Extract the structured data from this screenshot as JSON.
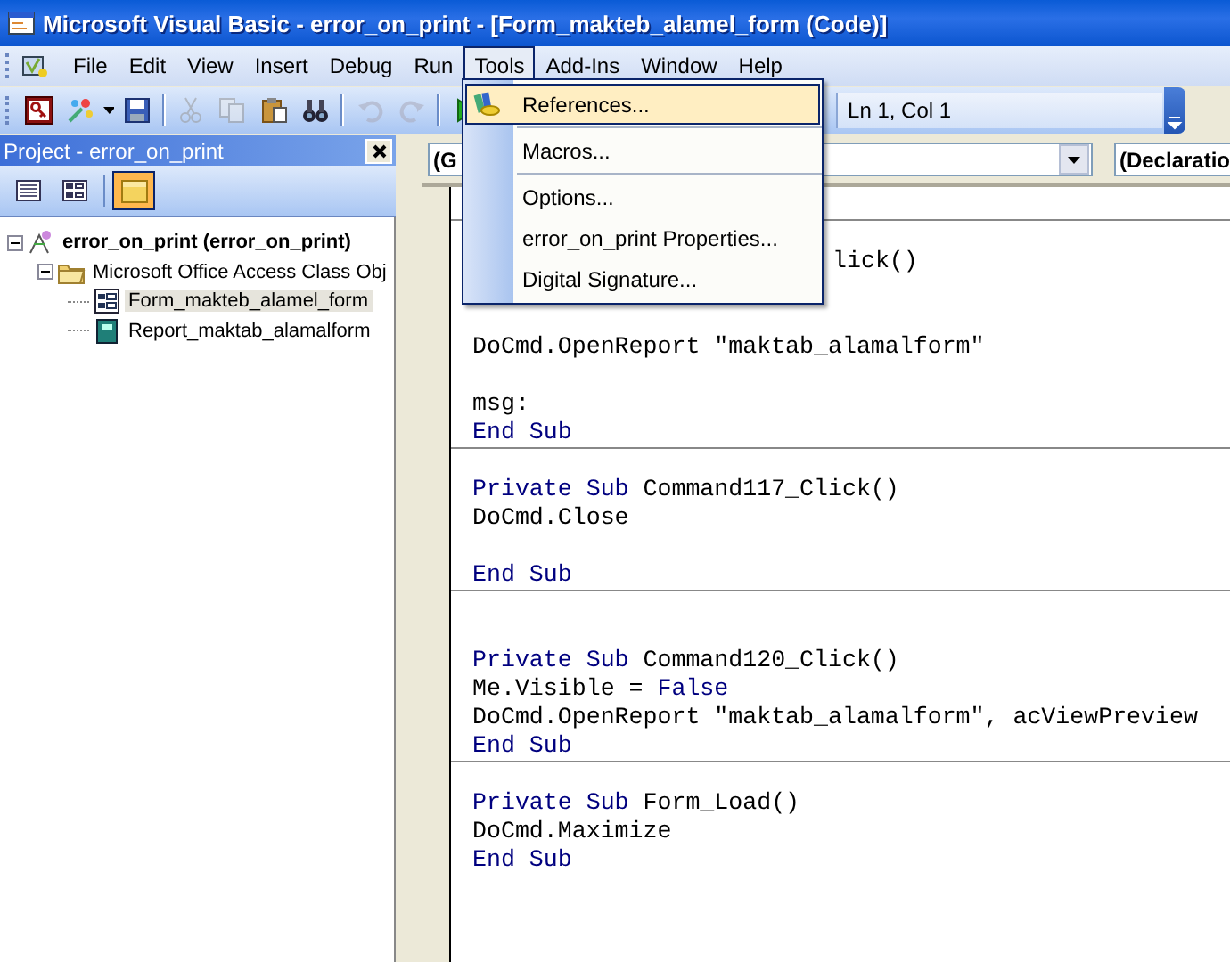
{
  "window": {
    "title": "Microsoft Visual Basic - error_on_print - [Form_makteb_alamel_form (Code)]"
  },
  "menu_bar": [
    {
      "label": "File",
      "selected": false
    },
    {
      "label": "Edit",
      "selected": false
    },
    {
      "label": "View",
      "selected": false
    },
    {
      "label": "Insert",
      "selected": false
    },
    {
      "label": "Debug",
      "selected": false
    },
    {
      "label": "Run",
      "selected": false
    },
    {
      "label": "Tools",
      "selected": true
    },
    {
      "label": "Add-Ins",
      "selected": false
    },
    {
      "label": "Window",
      "selected": false
    },
    {
      "label": "Help",
      "selected": false
    }
  ],
  "tools_menu": [
    {
      "label": "References...",
      "selected": true,
      "separator_after": true
    },
    {
      "label": "Macros...",
      "selected": false,
      "separator_after": true
    },
    {
      "label": "Options...",
      "selected": false,
      "separator_after": false
    },
    {
      "label": "error_on_print Properties...",
      "selected": false,
      "separator_after": false
    },
    {
      "label": "Digital Signature...",
      "selected": false,
      "separator_after": false
    }
  ],
  "toolbar": {
    "buttons": [
      {
        "kind": "access",
        "disabled": false
      },
      {
        "kind": "insert",
        "disabled": false
      },
      {
        "kind": "save",
        "disabled": false
      },
      {
        "kind": "separator"
      },
      {
        "kind": "cut",
        "disabled": true
      },
      {
        "kind": "copy",
        "disabled": true
      },
      {
        "kind": "paste",
        "disabled": false
      },
      {
        "kind": "find",
        "disabled": false
      },
      {
        "kind": "separator"
      },
      {
        "kind": "undo",
        "disabled": true
      },
      {
        "kind": "redo",
        "disabled": true
      },
      {
        "kind": "separator"
      },
      {
        "kind": "run"
      }
    ],
    "position": "Ln 1, Col 1"
  },
  "project": {
    "title": "Project - error_on_print",
    "buttons": [
      {
        "kind": "view-code",
        "selected": false
      },
      {
        "kind": "view-object",
        "selected": false
      },
      {
        "kind": "toggle-folders",
        "selected": true
      }
    ],
    "tree": [
      {
        "label": "error_on_print (error_on_print)",
        "kind": "project",
        "expanded": true,
        "selected": false,
        "children": [
          {
            "label": "Microsoft Office Access Class Obj",
            "kind": "folder",
            "expanded": true,
            "selected": false,
            "children": [
              {
                "label": "Form_makteb_alamel_form",
                "kind": "form",
                "selected": true
              },
              {
                "label": "Report_maktab_alamalform",
                "kind": "report",
                "selected": false
              }
            ]
          }
        ]
      }
    ]
  },
  "code": {
    "object_combo": "(G",
    "procedure_combo": "(Declaratio",
    "lines": [
      {
        "divider": false
      },
      {
        "divider": true
      },
      {
        "divider": false,
        "kind": "clipped",
        "tokens": [
          {
            "text": "lick()",
            "kind": "plain"
          }
        ]
      },
      {
        "divider": false
      },
      {
        "divider": false
      },
      {
        "divider": false,
        "kind": "code",
        "tokens": [
          {
            "text": "DoCmd.OpenReport \"maktab_alamalform\"",
            "kind": "plain"
          }
        ]
      },
      {
        "divider": false
      },
      {
        "divider": false,
        "kind": "code",
        "tokens": [
          {
            "text": "msg:",
            "kind": "plain"
          }
        ]
      },
      {
        "divider": false,
        "kind": "code",
        "tokens": [
          {
            "text": "End Sub",
            "kind": "keyword"
          }
        ]
      },
      {
        "divider": true
      },
      {
        "divider": false,
        "kind": "code",
        "tokens": [
          {
            "text": "Private Sub",
            "kind": "keyword"
          },
          {
            "text": " Command117_Click()",
            "kind": "plain"
          }
        ]
      },
      {
        "divider": false,
        "kind": "code",
        "tokens": [
          {
            "text": "DoCmd.Close",
            "kind": "plain"
          }
        ]
      },
      {
        "divider": false
      },
      {
        "divider": false,
        "kind": "code",
        "tokens": [
          {
            "text": "End Sub",
            "kind": "keyword"
          }
        ]
      },
      {
        "divider": true
      },
      {
        "divider": false
      },
      {
        "divider": false,
        "kind": "code",
        "tokens": [
          {
            "text": "Private Sub",
            "kind": "keyword"
          },
          {
            "text": " Command120_Click()",
            "kind": "plain"
          }
        ]
      },
      {
        "divider": false,
        "kind": "code",
        "tokens": [
          {
            "text": "Me.Visible = ",
            "kind": "plain"
          },
          {
            "text": "False",
            "kind": "keyword"
          }
        ]
      },
      {
        "divider": false,
        "kind": "code",
        "tokens": [
          {
            "text": "DoCmd.OpenReport \"maktab_alamalform\", acViewPreview",
            "kind": "plain"
          }
        ]
      },
      {
        "divider": false,
        "kind": "code",
        "tokens": [
          {
            "text": "End Sub",
            "kind": "keyword"
          }
        ]
      },
      {
        "divider": true
      },
      {
        "divider": false,
        "kind": "code",
        "tokens": [
          {
            "text": "Private Sub",
            "kind": "keyword"
          },
          {
            "text": " Form_Load()",
            "kind": "plain"
          }
        ]
      },
      {
        "divider": false,
        "kind": "code",
        "tokens": [
          {
            "text": "DoCmd.Maximize",
            "kind": "plain"
          }
        ]
      },
      {
        "divider": false,
        "kind": "code",
        "tokens": [
          {
            "text": "End Sub",
            "kind": "keyword"
          }
        ]
      }
    ]
  }
}
